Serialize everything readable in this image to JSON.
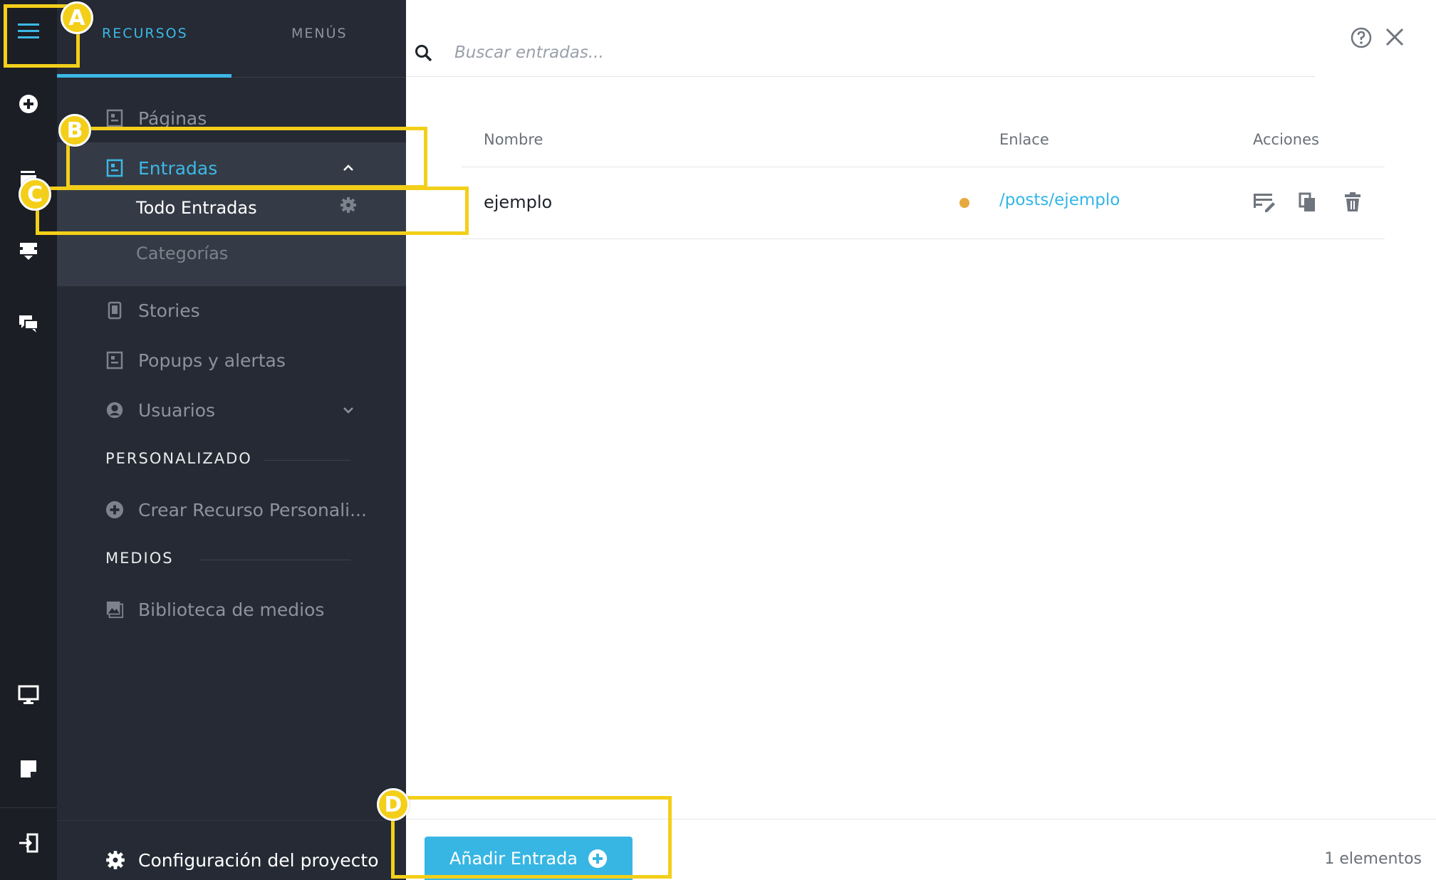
{
  "tabs": {
    "active": "RECURSOS",
    "inactive": "MENÚS"
  },
  "nav": {
    "pages": "Páginas",
    "entries": "Entradas",
    "sub_all": "Todo Entradas",
    "sub_categories": "Categorías",
    "stories": "Stories",
    "popups": "Popups y alertas",
    "users": "Usuarios",
    "section_custom": "PERSONALIZADO",
    "create_custom": "Crear Recurso Personali...",
    "section_media": "MEDIOS",
    "media_library": "Biblioteca de medios",
    "project_settings": "Configuración del proyecto"
  },
  "search": {
    "placeholder": "Buscar entradas..."
  },
  "table": {
    "headers": {
      "name": "Nombre",
      "link": "Enlace",
      "actions": "Acciones"
    },
    "rows": [
      {
        "name": "ejemplo",
        "link": "/posts/ejemplo",
        "status_color": "#e5a93d"
      }
    ]
  },
  "footer": {
    "add_button": "Añadir Entrada",
    "count": "1 elementos"
  },
  "annotations": {
    "a": "A",
    "b": "B",
    "c": "C",
    "d": "D"
  },
  "colors": {
    "accent": "#37b6e4",
    "highlight": "#f3cf1a",
    "sidebar": "#252a34",
    "rail": "#1b1e24"
  }
}
